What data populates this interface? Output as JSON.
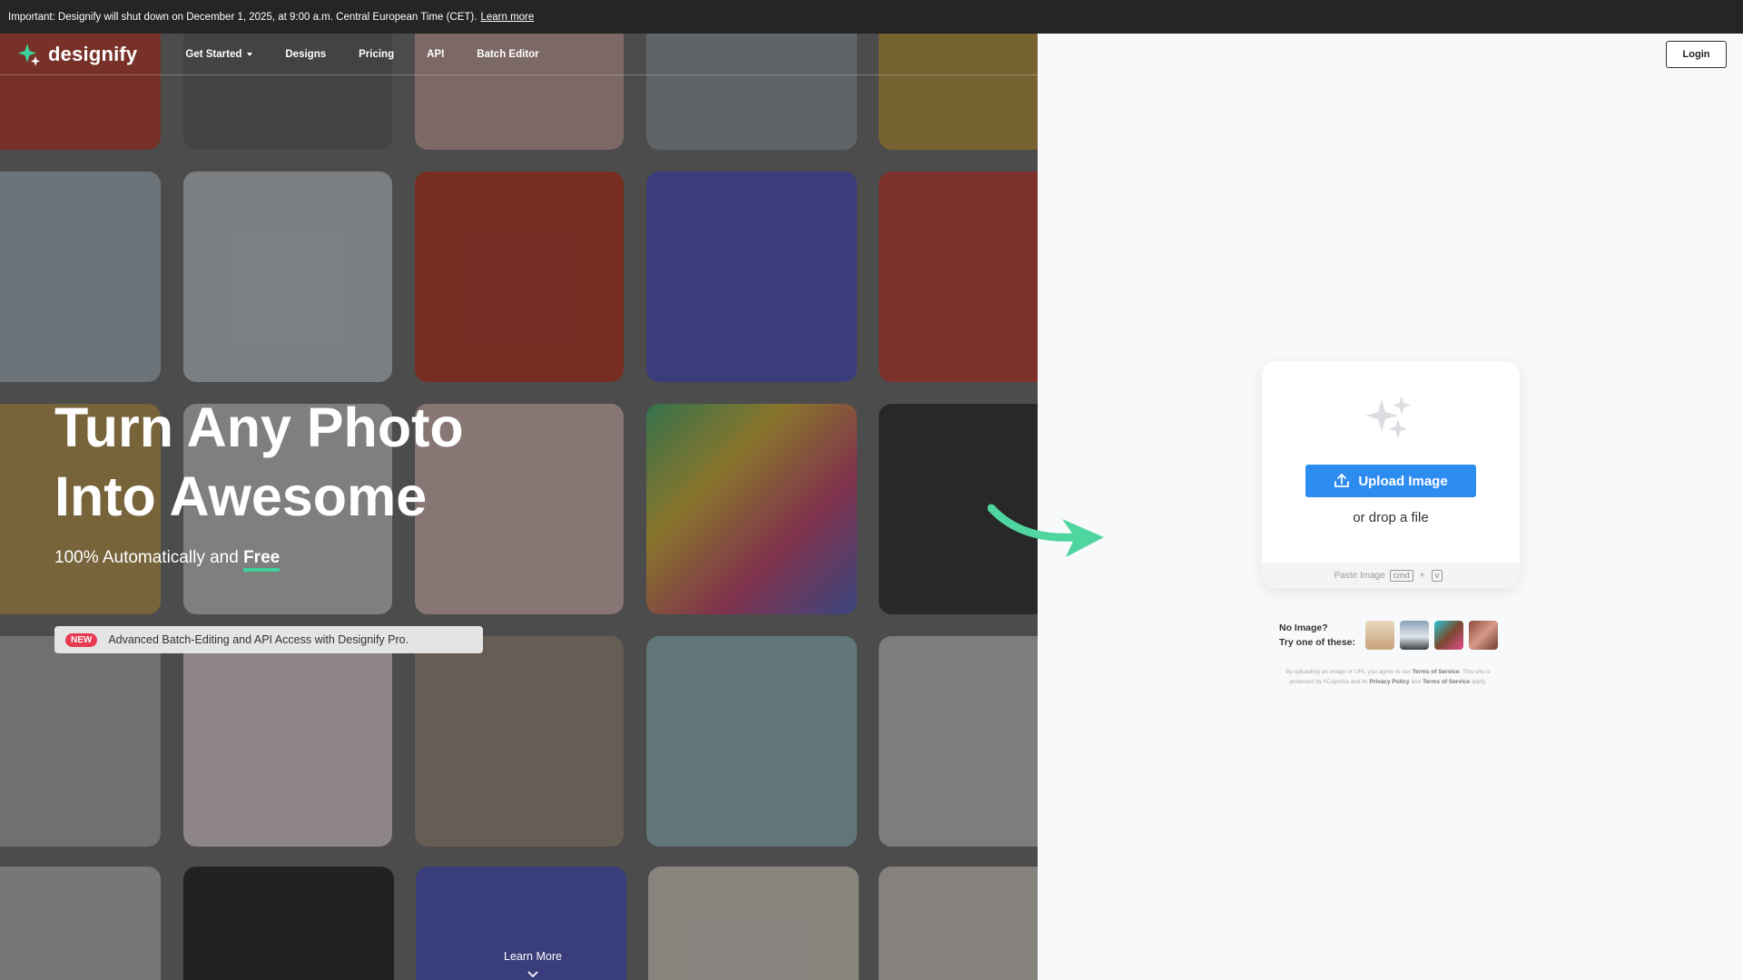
{
  "announcement": {
    "text": "Important: Designify will shut down on December 1, 2025, at 9:00 a.m. Central European Time (CET).",
    "link": "Learn more"
  },
  "nav": {
    "logo": "designify",
    "items": [
      {
        "label": "Get Started",
        "dropdown": true
      },
      {
        "label": "Designs"
      },
      {
        "label": "Pricing"
      },
      {
        "label": "API"
      },
      {
        "label": "Batch Editor"
      }
    ],
    "login": "Login"
  },
  "hero": {
    "title_line1": "Turn Any Photo",
    "title_line2": "Into Awesome",
    "subtitle_prefix": "100% Automatically and",
    "subtitle_free": "Free",
    "promo_badge": "NEW",
    "promo_text": "Advanced Batch-Editing and API Access with Designify Pro.",
    "learn_more": "Learn More"
  },
  "upload": {
    "button": "Upload Image",
    "drop": "or drop a file",
    "paste": "Paste Image",
    "key1": "cmd",
    "plus": "+",
    "key2": "v"
  },
  "samples": {
    "line1": "No Image?",
    "line2": "Try one of these:"
  },
  "legal": {
    "t1": "By uploading an image or URL you agree to our",
    "tos": "Terms of Service",
    "t2": ". This site is protected by hCaptcha and its",
    "privacy": "Privacy Policy",
    "and": "and",
    "tos2": "Terms of Service",
    "t3": "apply."
  },
  "colors": {
    "accent": "#2d8cf0",
    "brand_green": "#3ed19a",
    "badge_red": "#e53a50",
    "topbar": "#252525"
  }
}
